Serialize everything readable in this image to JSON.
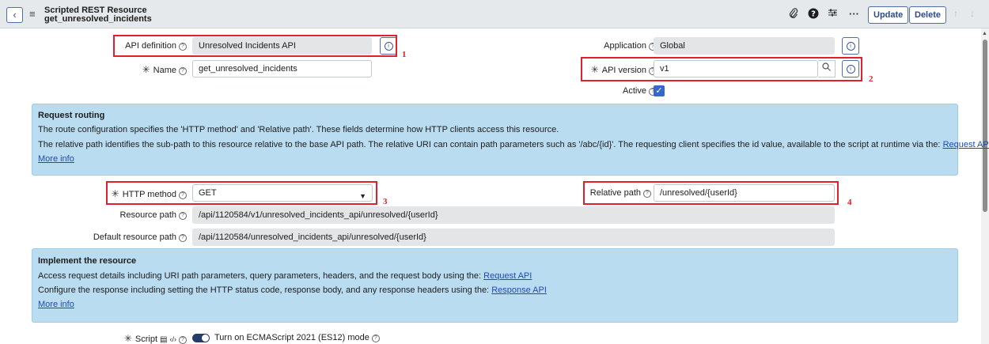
{
  "header": {
    "back_icon": "chevron-left-icon",
    "menu_icon": "hamburger-icon",
    "title": "Scripted REST Resource",
    "subtitle": "get_unresolved_incidents",
    "icons": [
      "paperclip-icon",
      "help-icon",
      "settings-sliders-icon",
      "more-icon"
    ],
    "update_label": "Update",
    "delete_label": "Delete"
  },
  "form": {
    "api_definition": {
      "label": "API definition",
      "value": "Unresolved Incidents API"
    },
    "name": {
      "label": "Name",
      "value": "get_unresolved_incidents"
    },
    "application": {
      "label": "Application",
      "value": "Global"
    },
    "api_version": {
      "label": "API version",
      "value": "v1"
    },
    "active": {
      "label": "Active",
      "checked": true
    },
    "http_method": {
      "label": "HTTP method",
      "value": "GET"
    },
    "relative_path": {
      "label": "Relative path",
      "value": "/unresolved/{userId}"
    },
    "resource_path": {
      "label": "Resource path",
      "value": "/api/1120584/v1/unresolved_incidents_api/unresolved/{userId}"
    },
    "default_resource_path": {
      "label": "Default resource path",
      "value": "/api/1120584/unresolved_incidents_api/unresolved/{userId}"
    },
    "script": {
      "label": "Script",
      "toggle_label": "Turn on ECMAScript 2021 (ES12) mode"
    }
  },
  "annotations": {
    "tag1": "1",
    "tag2": "2",
    "tag3": "3",
    "tag4": "4",
    "color": "#e0202a"
  },
  "request_routing": {
    "title": "Request routing",
    "line1": "The route configuration specifies the 'HTTP method' and 'Relative path'. These fields determine how HTTP clients access this resource.",
    "line2": "The relative path identifies the sub-path to this resource relative to the base API path. The relative URI can contain path parameters such as '/abc/{id}'. The requesting client specifies the id value, available to the script at runtime via the:",
    "line2_link": "Request API",
    "more_info": "More info"
  },
  "implement": {
    "title": "Implement the resource",
    "line1": "Access request details including URI path parameters, query parameters, headers, and the request body using the:",
    "line1_link": "Request API",
    "line2": "Configure the response including setting the HTTP status code, response body, and any response headers using the:",
    "line2_link": "Response API",
    "more_info": "More info"
  },
  "colors": {
    "panel_bg": "#b9dcf0",
    "accent": "#3568c9",
    "link": "#1f4bb0"
  }
}
